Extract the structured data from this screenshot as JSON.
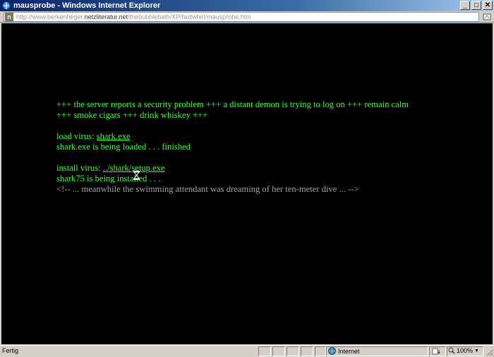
{
  "window": {
    "title": "mausprobe - Windows Internet Explorer",
    "buttons": {
      "minimize": "_",
      "maximize": "□",
      "close": "✕"
    }
  },
  "address": {
    "icon_letter": "n",
    "url_prefix": "http://www.berkenheger.",
    "url_host": "netzliteratur.net",
    "url_path": "/thebubblebath/XP/fastwhirl/mausprobe.htm"
  },
  "content": {
    "line1": "+++ the server reports a security problem +++ a distant demon is trying to log on +++ remain calm",
    "line2": "+++ smoke cigars +++ drink whiskey +++",
    "load_label": "load virus: ",
    "load_link": "shark.exe",
    "load_status": "shark.exe is being loaded . . . finished",
    "install_label": "install virus: ",
    "install_link": "../shark/setup.exe",
    "install_status": "shark75 is being installed . . .",
    "comment": "<!-- ... meanwhile the swimming attendant was dreaming of her ten-meter dive ... -->"
  },
  "status": {
    "text": "Fertig",
    "zone": "Internet",
    "zoom": "100%"
  },
  "colors": {
    "terminal_green": "#33ff33",
    "comment_gray": "#a0a0a0",
    "background": "#000000"
  }
}
